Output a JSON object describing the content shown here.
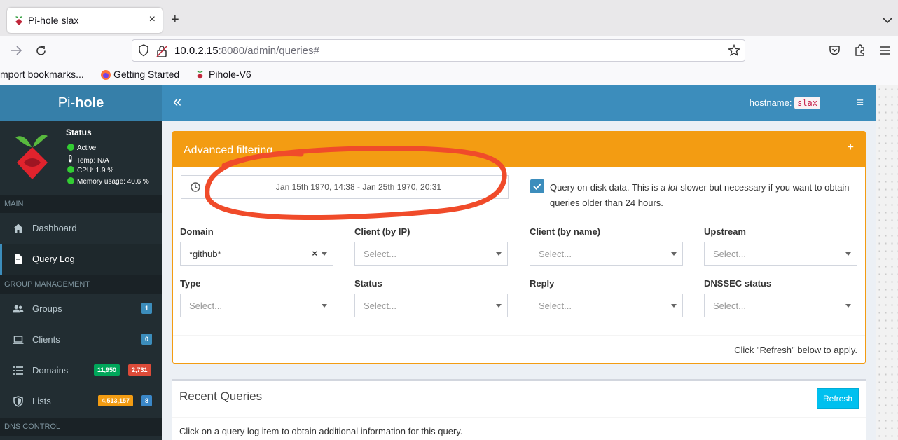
{
  "browser": {
    "tab_title": "Pi-hole slax",
    "tab_close": "×",
    "new_tab": "+",
    "url_host": "10.0.2.15",
    "url_rest": ":8080/admin/queries#",
    "bookmarks": [
      "mport bookmarks...",
      "Getting Started",
      "Pihole-V6"
    ]
  },
  "sidebar": {
    "logo_prefix": "Pi-",
    "logo_bold": "hole",
    "status": {
      "title": "Status",
      "active": "Active",
      "temp": "Temp: N/A",
      "cpu": "CPU: 1.9 %",
      "memory": "Memory usage: 40.6 %"
    },
    "section_main": "MAIN",
    "dashboard": "Dashboard",
    "query_log": "Query Log",
    "section_group": "GROUP MANAGEMENT",
    "groups": {
      "label": "Groups",
      "badge": "1"
    },
    "clients": {
      "label": "Clients",
      "badge": "0"
    },
    "domains": {
      "label": "Domains",
      "badge_allowed": "11,950",
      "badge_denied": "2,731"
    },
    "lists": {
      "label": "Lists",
      "badge_domains": "4,513,157",
      "badge_count": "8"
    },
    "section_dns": "DNS CONTROL"
  },
  "topbar": {
    "toggle": "«",
    "hostname_label": "hostname:",
    "hostname_value": "slax",
    "menu": "≡"
  },
  "filter": {
    "title": "Advanced filtering",
    "expand": "+",
    "daterange": "Jan 15th 1970, 14:38 - Jan 25th 1970, 20:31",
    "ondisk_pre": "Query on-disk data. This is ",
    "ondisk_em": "a lot",
    "ondisk_post": " slower but necessary if you want to obtain queries older than 24 hours.",
    "labels": {
      "domain": "Domain",
      "client_ip": "Client (by IP)",
      "client_name": "Client (by name)",
      "upstream": "Upstream",
      "type": "Type",
      "status": "Status",
      "reply": "Reply",
      "dnssec": "DNSSEC status"
    },
    "domain_value": "*github*",
    "clear": "×",
    "placeholder": "Select...",
    "apply_note": "Click \"Refresh\" below to apply."
  },
  "recent": {
    "title": "Recent Queries",
    "refresh": "Refresh",
    "info": "Click on a query log item to obtain additional information for this query."
  },
  "colors": {
    "accent": "#3c8dbc",
    "warning": "#f39c12",
    "annotation": "#f04b2a"
  }
}
